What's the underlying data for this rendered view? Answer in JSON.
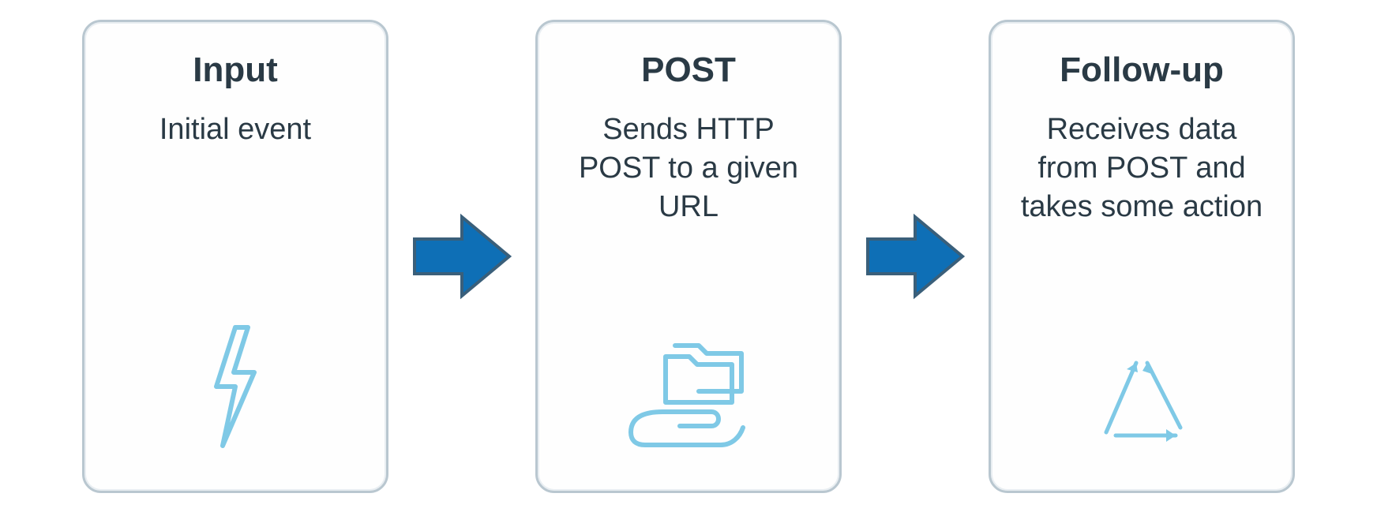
{
  "colors": {
    "card_border": "#b9c7d0",
    "text": "#2a3a45",
    "arrow_fill": "#0e6fb6",
    "arrow_stroke": "#3a5f7a",
    "icon_stroke": "#7fc9e6"
  },
  "flow": {
    "steps": [
      {
        "title": "Input",
        "description": "Initial event",
        "icon": "lightning-icon"
      },
      {
        "title": "POST",
        "description": "Sends HTTP POST to a given URL",
        "icon": "hand-folder-icon"
      },
      {
        "title": "Follow-up",
        "description": "Receives data from POST and takes some action",
        "icon": "cycle-triangle-icon"
      }
    ]
  }
}
